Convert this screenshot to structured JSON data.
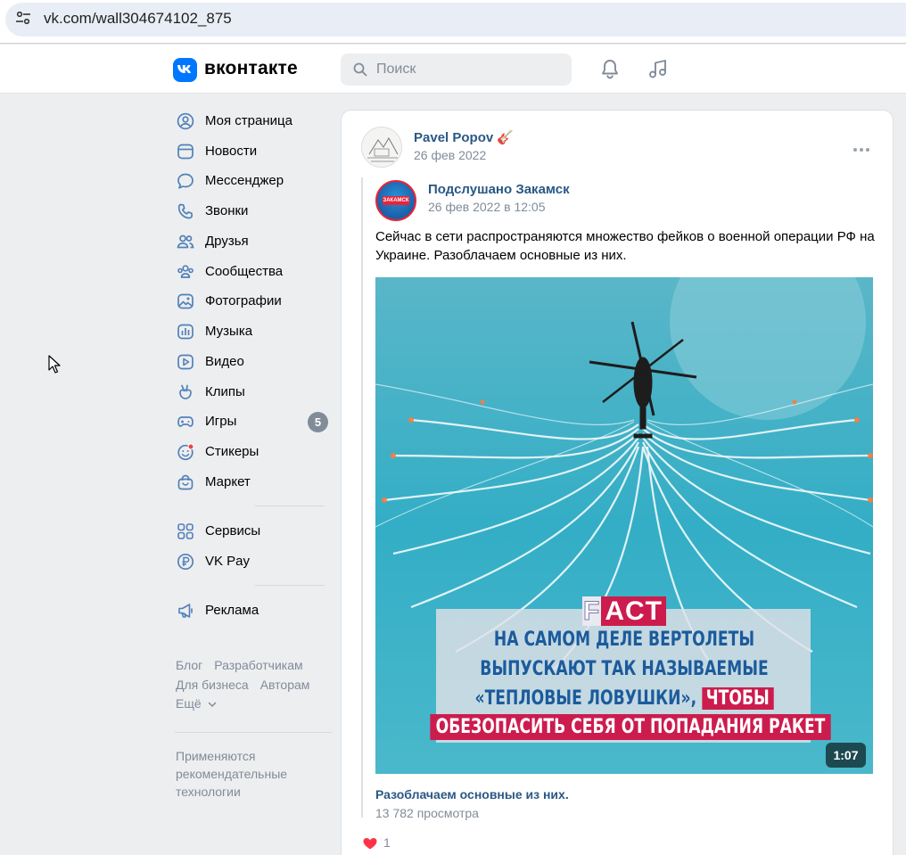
{
  "browser": {
    "url": "vk.com/wall304674102_875"
  },
  "header": {
    "logo_text": "вконтакте",
    "search_placeholder": "Поиск"
  },
  "sidebar": {
    "items": [
      {
        "label": "Моя страница",
        "icon": "user-circle-icon"
      },
      {
        "label": "Новости",
        "icon": "news-icon"
      },
      {
        "label": "Мессенджер",
        "icon": "message-icon"
      },
      {
        "label": "Звонки",
        "icon": "phone-icon"
      },
      {
        "label": "Друзья",
        "icon": "friends-icon"
      },
      {
        "label": "Сообщества",
        "icon": "communities-icon"
      },
      {
        "label": "Фотографии",
        "icon": "photo-icon"
      },
      {
        "label": "Музыка",
        "icon": "music-icon"
      },
      {
        "label": "Видео",
        "icon": "video-icon"
      },
      {
        "label": "Клипы",
        "icon": "clips-icon"
      },
      {
        "label": "Игры",
        "icon": "games-icon",
        "badge": "5"
      },
      {
        "label": "Стикеры",
        "icon": "stickers-icon"
      },
      {
        "label": "Маркет",
        "icon": "market-icon"
      }
    ],
    "services": [
      {
        "label": "Сервисы",
        "icon": "services-icon"
      },
      {
        "label": "VK Pay",
        "icon": "vkpay-icon"
      }
    ],
    "ads": {
      "label": "Реклама",
      "icon": "megaphone-icon"
    },
    "footer": {
      "row1": [
        "Блог",
        "Разработчикам"
      ],
      "row2": [
        "Для бизнеса",
        "Авторам"
      ],
      "more": "Ещё"
    },
    "recommendation_note": "Применяются рекомендательные технологии"
  },
  "post": {
    "author": "Pavel Popov",
    "author_emoji": "🎸",
    "date": "26 фев 2022",
    "repost": {
      "group": "Подслушано Закамск",
      "group_avatar_text": "ЗАКАМСК",
      "date": "26 фев 2022 в 12:05",
      "text": "Сейчас в сети распространяются множество фейков о военной операции РФ на Украине. Разоблачаем основные из них."
    },
    "video": {
      "fact_f": "F",
      "fact_act": "ACT",
      "line1": "НА САМОМ ДЕЛЕ ВЕРТОЛЕТЫ",
      "line2": "ВЫПУСКАЮТ ТАК НАЗЫВАЕМЫЕ",
      "line3": "«ТЕПЛОВЫЕ ЛОВУШКИ»,",
      "line3_highlight": "ЧТОБЫ",
      "line4": "ОБЕЗОПАСИТЬ СЕБЯ ОТ ПОПАДАНИЯ РАКЕТ",
      "duration": "1:07",
      "title": "Разоблачаем основные из них.",
      "views": "13 782 просмотра"
    },
    "likes": "1"
  }
}
